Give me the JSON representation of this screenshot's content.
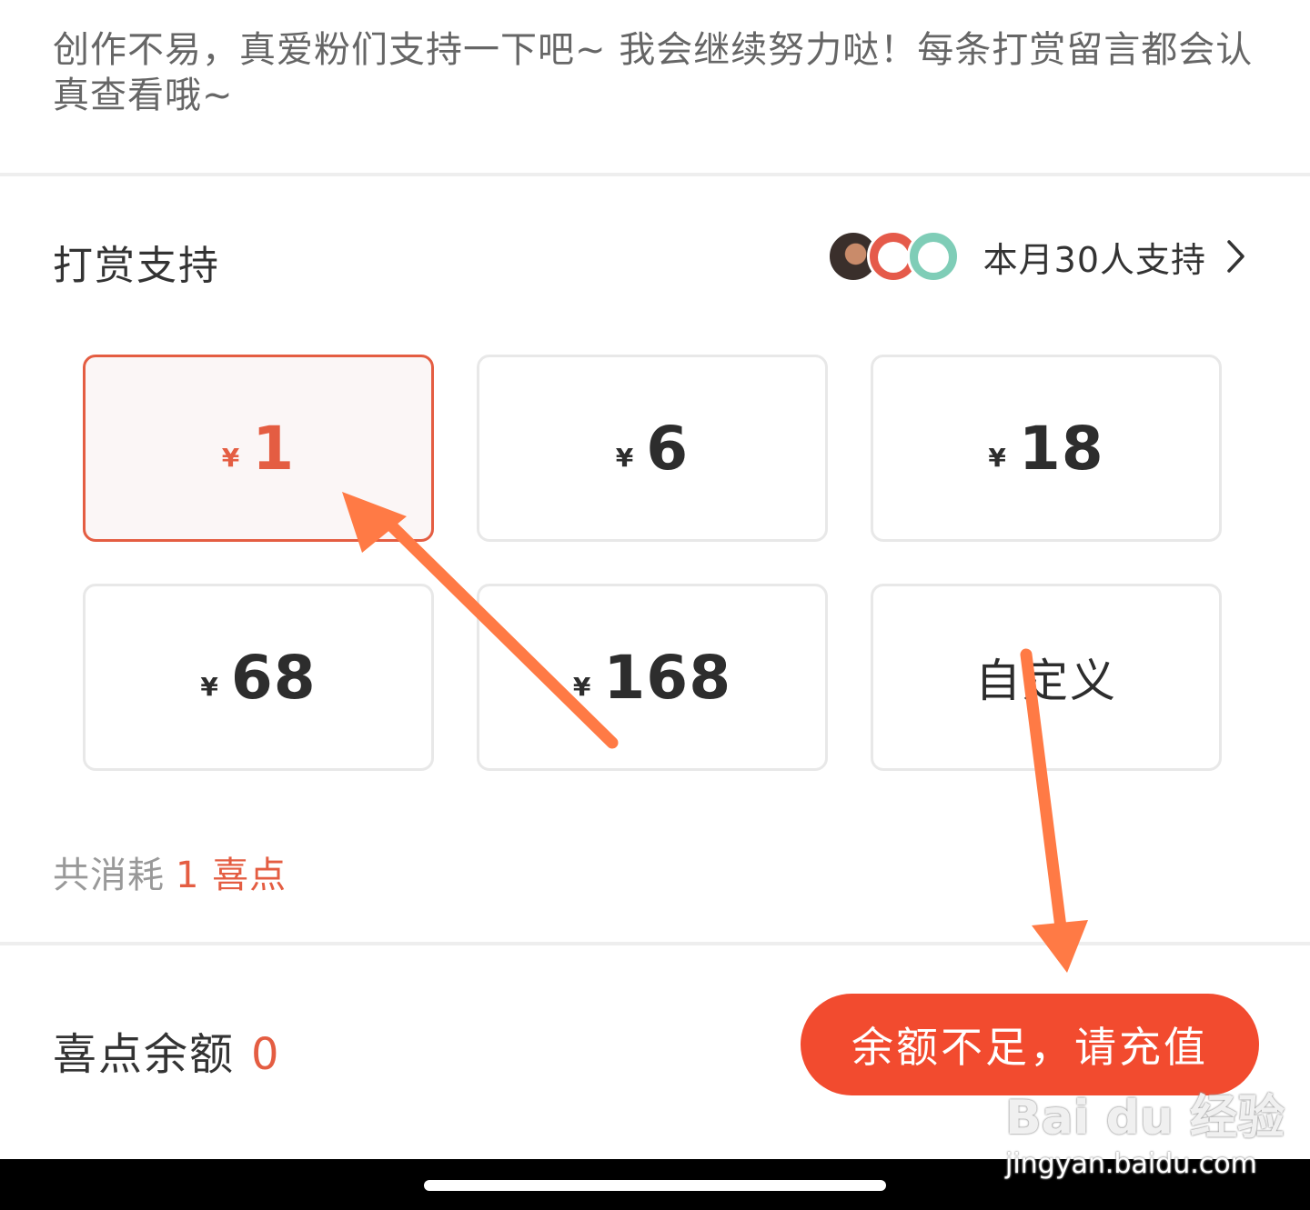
{
  "intro_text": "创作不易，真爱粉们支持一下吧~ 我会继续努力哒！每条打赏留言都会认真查看哦~",
  "reward": {
    "title": "打赏支持",
    "supporters_text": "本月30人支持",
    "options": [
      {
        "currency": "¥",
        "amount": "1",
        "selected": true
      },
      {
        "currency": "¥",
        "amount": "6",
        "selected": false
      },
      {
        "currency": "¥",
        "amount": "18",
        "selected": false
      },
      {
        "currency": "¥",
        "amount": "68",
        "selected": false
      },
      {
        "currency": "¥",
        "amount": "168",
        "selected": false
      }
    ],
    "custom_label": "自定义",
    "consume_label": "共消耗",
    "consume_value": "1 喜点"
  },
  "footer": {
    "balance_label": "喜点余额",
    "balance_value": "0",
    "recharge_label": "余额不足，请充值"
  },
  "watermark": {
    "logo_text": "Bai du 经验",
    "url": "jingyan.baidu.com"
  },
  "colors": {
    "accent": "#e45d42",
    "button": "#f24b2f",
    "annotation_arrow": "#ff7a45"
  }
}
